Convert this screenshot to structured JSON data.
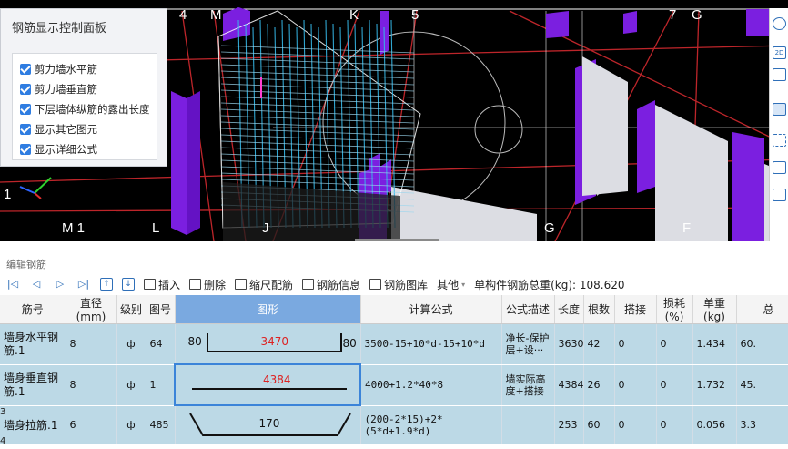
{
  "viewport": {
    "axis_labels": [
      "4",
      "M",
      "K",
      "5",
      "7",
      "G",
      "1",
      "M 1",
      "L",
      "J",
      "G",
      "F"
    ]
  },
  "control_panel": {
    "title": "钢筋显示控制面板",
    "options": [
      {
        "label": "剪力墙水平筋",
        "checked": true
      },
      {
        "label": "剪力墙垂直筋",
        "checked": true
      },
      {
        "label": "下层墙体纵筋的露出长度",
        "checked": true
      },
      {
        "label": "显示其它图元",
        "checked": true
      },
      {
        "label": "显示详细公式",
        "checked": true
      }
    ]
  },
  "right_toolbar": {
    "icons": [
      "orbit-icon",
      "2d-icon",
      "cube-icon",
      "cube-side-icon",
      "select-box-icon",
      "view-icon",
      "list-icon"
    ],
    "label_2d": "2D"
  },
  "editor": {
    "panel_title": "编辑钢筋",
    "toolbar": {
      "insert": "插入",
      "delete": "删除",
      "scale_rebar": "缩尺配筋",
      "rebar_info": "钢筋信息",
      "rebar_library": "钢筋图库",
      "other": "其他",
      "total_weight_label": "单构件钢筋总重(kg): 108.620"
    },
    "columns": [
      "筋号",
      "直径(mm)",
      "级别",
      "图号",
      "图形",
      "计算公式",
      "公式描述",
      "长度",
      "根数",
      "搭接",
      "损耗(%)",
      "单重(kg)",
      "总"
    ],
    "rows": [
      {
        "num": "",
        "name": "墙身水平钢筋.1",
        "diameter": "8",
        "grade": "ф",
        "fig_no": "64",
        "shape_left": "80",
        "shape_mid": "3470",
        "shape_right": "80",
        "formula": "3500-15+10*d-15+10*d",
        "desc": "净长-保护层+设···",
        "length": "3630",
        "count": "42",
        "lap": "0",
        "loss": "0",
        "unit_weight": "1.434",
        "total": "60."
      },
      {
        "num": "",
        "name": "墙身垂直钢筋.1",
        "diameter": "8",
        "grade": "ф",
        "fig_no": "1",
        "shape_mid": "4384",
        "formula": "4000+1.2*40*8",
        "desc": "墙实际高度+搭接",
        "length": "4384",
        "count": "26",
        "lap": "0",
        "loss": "0",
        "unit_weight": "1.732",
        "total": "45."
      },
      {
        "num": "3",
        "name": "墙身拉筋.1",
        "diameter": "6",
        "grade": "ф",
        "fig_no": "485",
        "shape_mid": "170",
        "formula": "(200-2*15)+2*(5*d+1.9*d)",
        "desc": "",
        "length": "253",
        "count": "60",
        "lap": "0",
        "loss": "0",
        "unit_weight": "0.056",
        "total": "3.3"
      }
    ],
    "next_row_num": "4"
  },
  "colors": {
    "wall_purple": "#7b1fe0",
    "grid_red": "#c8282d",
    "rebar_cyan": "#36b8e8",
    "row_bg": "#bcd9e6",
    "header_sel": "#7aa9e0"
  }
}
